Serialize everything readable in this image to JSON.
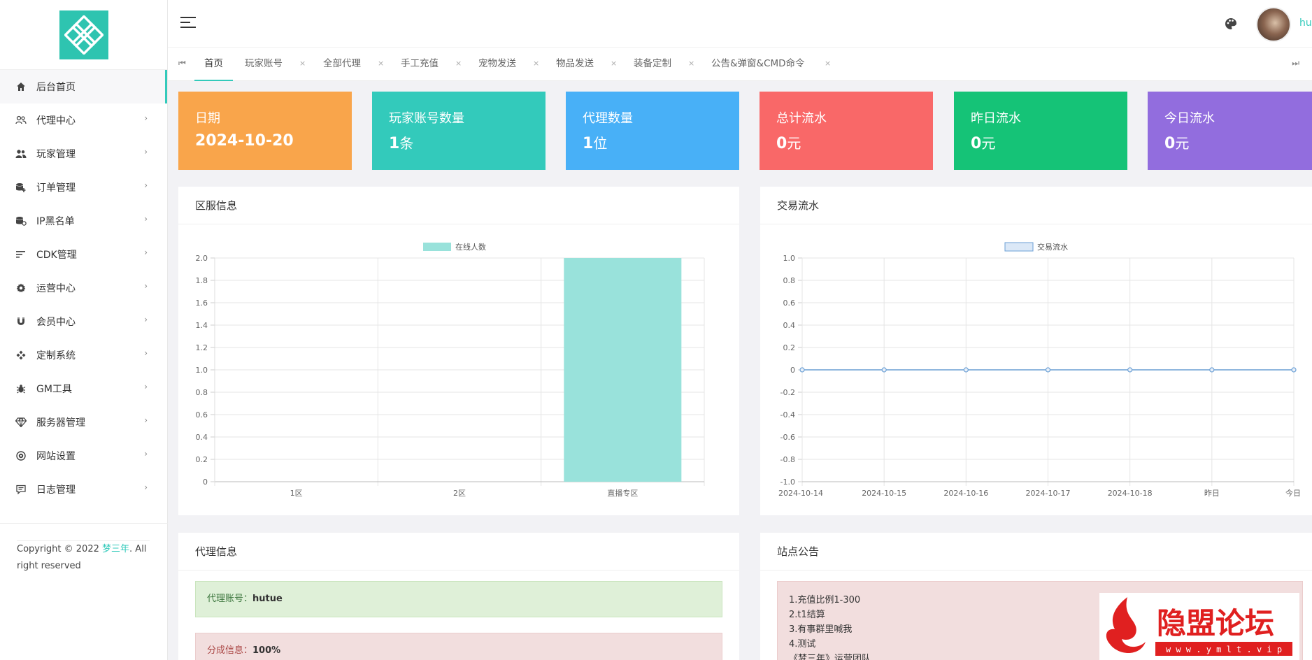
{
  "sidebar": {
    "items": [
      {
        "label": "后台首页",
        "icon": "home-icon"
      },
      {
        "label": "代理中心",
        "icon": "users-outline-icon"
      },
      {
        "label": "玩家管理",
        "icon": "users-icon"
      },
      {
        "label": "订单管理",
        "icon": "database-plus-icon"
      },
      {
        "label": "IP黑名单",
        "icon": "database-ban-icon"
      },
      {
        "label": "CDK管理",
        "icon": "sort-lines-icon"
      },
      {
        "label": "运营中心",
        "icon": "gear-icon"
      },
      {
        "label": "会员中心",
        "icon": "magnet-icon"
      },
      {
        "label": "定制系统",
        "icon": "puzzle-icon"
      },
      {
        "label": "GM工具",
        "icon": "bug-icon"
      },
      {
        "label": "服务器管理",
        "icon": "diamond-icon"
      },
      {
        "label": "网站设置",
        "icon": "globe-icon"
      },
      {
        "label": "日志管理",
        "icon": "message-icon"
      }
    ],
    "copyright_prefix": "Copyright © 2022 ",
    "copyright_brand": "梦三年",
    "copyright_suffix": ". All right reserved"
  },
  "header": {
    "username": "hu"
  },
  "tabs": [
    {
      "label": "首页"
    },
    {
      "label": "玩家账号"
    },
    {
      "label": "全部代理"
    },
    {
      "label": "手工充值"
    },
    {
      "label": "宠物发送"
    },
    {
      "label": "物品发送"
    },
    {
      "label": "装备定制"
    },
    {
      "label": "公告&弹窗&CMD命令"
    }
  ],
  "tab_close": "×",
  "tab_first": "⏮",
  "tab_last": "⏭",
  "cards": [
    {
      "title": "日期",
      "value": "2024-10-20",
      "unit": "",
      "color": "#f9a54b"
    },
    {
      "title": "玩家账号数量",
      "value": "1",
      "unit": "条",
      "color": "#33cabb"
    },
    {
      "title": "代理数量",
      "value": "1",
      "unit": "位",
      "color": "#48b0f7"
    },
    {
      "title": "总计流水",
      "value": "0",
      "unit": "元",
      "color": "#f96868"
    },
    {
      "title": "昨日流水",
      "value": "0",
      "unit": "元",
      "color": "#15c377"
    },
    {
      "title": "今日流水",
      "value": "0",
      "unit": "元",
      "color": "#926dde"
    }
  ],
  "panels": {
    "server": {
      "title": "区服信息"
    },
    "trade": {
      "title": "交易流水"
    },
    "agent": {
      "title": "代理信息",
      "account_label": "代理账号：",
      "account_value": "hutue",
      "share_label": "分成信息：",
      "share_value": "100%"
    },
    "notice": {
      "title": "站点公告",
      "lines": [
        "1.充值比例1-300",
        "2.t1结算",
        "3.有事群里喊我",
        "4.测试",
        "《梦三年》运营团队"
      ]
    }
  },
  "watermark": {
    "title": "隐盟论坛",
    "url": "w w w . y m l t . v i p"
  },
  "chart_data": [
    {
      "type": "bar",
      "categories": [
        "1区",
        "2区",
        "直播专区"
      ],
      "series": [
        {
          "name": "在线人数",
          "values": [
            0,
            0,
            2
          ]
        }
      ],
      "ylim": [
        0,
        2.0
      ],
      "yticks": [
        "0",
        "0.2",
        "0.4",
        "0.6",
        "0.8",
        "1.0",
        "1.2",
        "1.4",
        "1.6",
        "1.8",
        "2.0"
      ],
      "legend": "top-center",
      "grid": true,
      "color": "#99e2db"
    },
    {
      "type": "line",
      "categories": [
        "2024-10-14",
        "2024-10-15",
        "2024-10-16",
        "2024-10-17",
        "2024-10-18",
        "昨日",
        "今日"
      ],
      "series": [
        {
          "name": "交易流水",
          "values": [
            0,
            0,
            0,
            0,
            0,
            0,
            0
          ]
        }
      ],
      "ylim": [
        -1.0,
        1.0
      ],
      "yticks": [
        "-1.0",
        "-0.8",
        "-0.6",
        "-0.4",
        "-0.2",
        "0",
        "0.2",
        "0.4",
        "0.6",
        "0.8",
        "1.0"
      ],
      "legend": "top-center",
      "grid": true,
      "color": "#6b9fd4"
    }
  ]
}
